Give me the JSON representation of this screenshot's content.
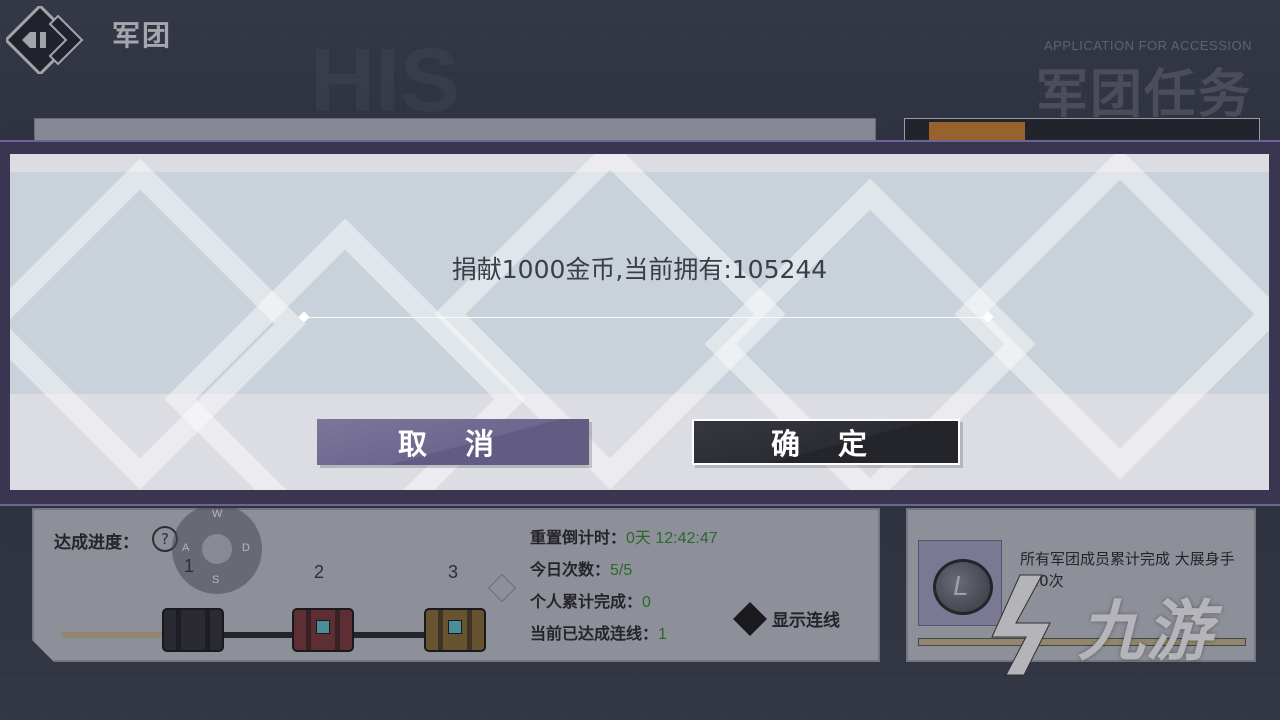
{
  "header": {
    "title": "军团",
    "bg_caption": "APPLICATION FOR ACCESSION",
    "bg_title": "军团任务"
  },
  "dialog": {
    "message": "捐献1000金币,当前拥有:105244",
    "cancel_label": "取 消",
    "confirm_label": "确 定"
  },
  "progress": {
    "label": "达成进度：",
    "help": "?",
    "steps": [
      "1",
      "2",
      "3"
    ],
    "wasd": {
      "w": "W",
      "a": "A",
      "s": "S",
      "d": "D"
    }
  },
  "stats": {
    "reset_label": "重置倒计时：",
    "reset_value": "0天 12:42:47",
    "today_label": "今日次数：",
    "today_value": "5/5",
    "personal_label": "个人累计完成：",
    "personal_value": "0",
    "lines_label": "当前已达成连线：",
    "lines_value": "1"
  },
  "show_lines_label": "显示连线",
  "task": {
    "text": "所有军团成员累计完成 大展身手 120次"
  },
  "watermark": "九游",
  "colors": {
    "cancel": "#6d6790",
    "confirm": "#2b2c33",
    "stat_value": "#2f8a2c"
  }
}
